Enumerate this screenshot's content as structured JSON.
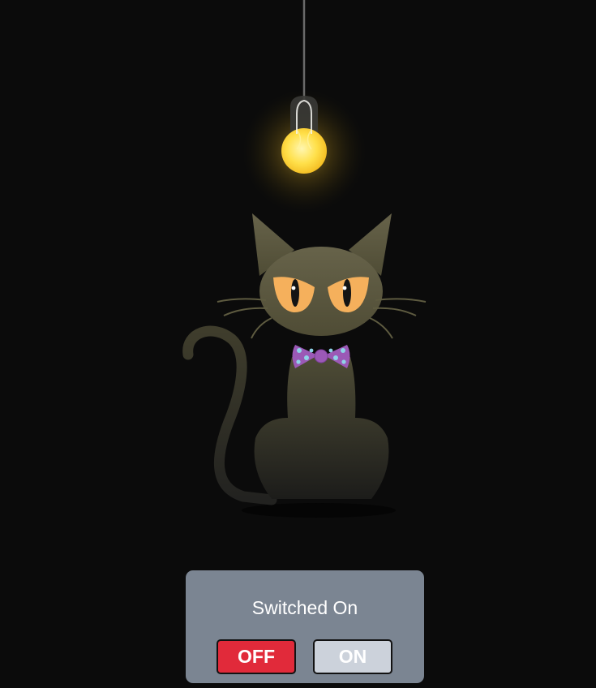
{
  "scene": {
    "background_color": "#0b0b0b",
    "bulb": {
      "state": "on",
      "glow_color": "#ffd84a",
      "icon": "lightbulb-icon"
    },
    "cat": {
      "fur_color": "#5d5a3c",
      "eye_color": "#f5b05c",
      "bowtie_color": "#9b59b6",
      "bowtie_dot_color": "#8fd3e8"
    }
  },
  "panel": {
    "status": "Switched On",
    "off_label": "OFF",
    "on_label": "ON",
    "panel_color": "#7b8592",
    "off_color": "#e12a3a",
    "on_color": "#ccd2db"
  }
}
